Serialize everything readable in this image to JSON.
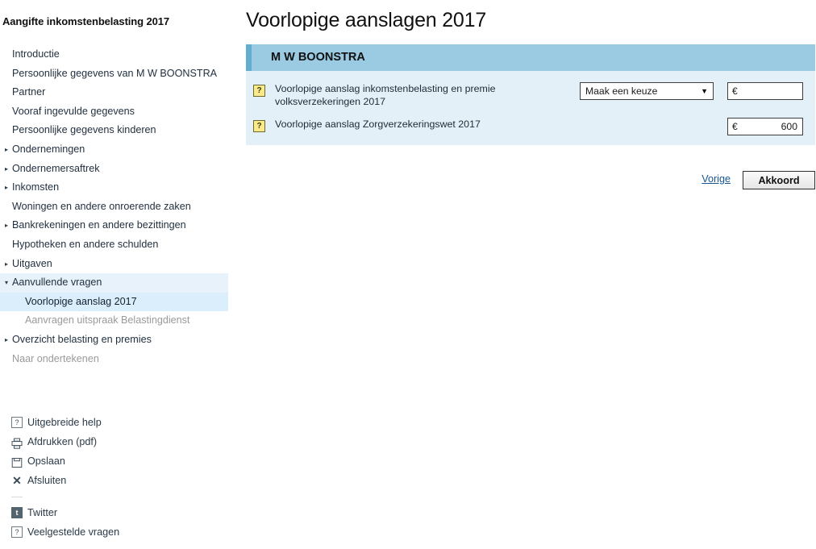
{
  "sidebar": {
    "title": "Aangifte inkomstenbelasting 2017",
    "items": [
      {
        "label": "Introductie",
        "level": 0,
        "arrow": "",
        "state": "normal"
      },
      {
        "label": "Persoonlijke gegevens van M W BOONSTRA",
        "level": 0,
        "arrow": "",
        "state": "normal"
      },
      {
        "label": "Partner",
        "level": 0,
        "arrow": "",
        "state": "normal"
      },
      {
        "label": "Vooraf ingevulde gegevens",
        "level": 0,
        "arrow": "",
        "state": "normal"
      },
      {
        "label": "Persoonlijke gegevens kinderen",
        "level": 0,
        "arrow": "",
        "state": "normal"
      },
      {
        "label": "Ondernemingen",
        "level": 0,
        "arrow": "▸",
        "state": "normal"
      },
      {
        "label": "Ondernemersaftrek",
        "level": 0,
        "arrow": "▸",
        "state": "normal"
      },
      {
        "label": "Inkomsten",
        "level": 0,
        "arrow": "▸",
        "state": "normal"
      },
      {
        "label": "Woningen en andere onroerende zaken",
        "level": 0,
        "arrow": "",
        "state": "normal"
      },
      {
        "label": "Bankrekeningen en andere bezittingen",
        "level": 0,
        "arrow": "▸",
        "state": "normal"
      },
      {
        "label": "Hypotheken en andere schulden",
        "level": 0,
        "arrow": "",
        "state": "normal"
      },
      {
        "label": "Uitgaven",
        "level": 0,
        "arrow": "▸",
        "state": "normal"
      },
      {
        "label": "Aanvullende vragen",
        "level": 0,
        "arrow": "▾",
        "state": "expanded"
      },
      {
        "label": "Voorlopige aanslag 2017",
        "level": 1,
        "arrow": "",
        "state": "selected"
      },
      {
        "label": "Aanvragen uitspraak Belastingdienst",
        "level": 1,
        "arrow": "",
        "state": "disabled"
      },
      {
        "label": "Overzicht belasting en premies",
        "level": 0,
        "arrow": "▸",
        "state": "normal"
      },
      {
        "label": "Naar ondertekenen",
        "level": 0,
        "arrow": "",
        "state": "disabled"
      }
    ],
    "footer": {
      "group1": [
        {
          "label": "Uitgebreide help",
          "icon": "question-box-icon",
          "glyph": "?"
        },
        {
          "label": "Afdrukken (pdf)",
          "icon": "printer-icon",
          "glyph": ""
        },
        {
          "label": "Opslaan",
          "icon": "save-icon",
          "glyph": ""
        },
        {
          "label": "Afsluiten",
          "icon": "close-x-icon",
          "glyph": "✕"
        }
      ],
      "group2": [
        {
          "label": "Twitter",
          "icon": "twitter-icon",
          "glyph": "t"
        },
        {
          "label": "Veelgestelde vragen",
          "icon": "question-box-icon",
          "glyph": "?"
        }
      ]
    }
  },
  "main": {
    "page_title": "Voorlopige aanslagen 2017",
    "panel": {
      "header_title": "M W BOONSTRA",
      "rows": [
        {
          "help_glyph": "?",
          "label": "Voorlopige aanslag inkomstenbelasting en premie volksverzekeringen 2017",
          "select": {
            "value": "Maak een keuze",
            "caret": "▼"
          },
          "money": {
            "currency": "€",
            "value": ""
          }
        },
        {
          "help_glyph": "?",
          "label": "Voorlopige aanslag Zorgverzekeringswet 2017",
          "select": null,
          "money": {
            "currency": "€",
            "value": "600"
          }
        }
      ]
    },
    "actions": {
      "previous_link": "Vorige",
      "submit_button": "Akkoord"
    }
  },
  "colors": {
    "panel_header": "#9bcbe3",
    "panel_header_edge": "#62aed1",
    "panel_body": "#e4f0f8",
    "nav_highlight": "#e7f2fa",
    "nav_highlight_strong": "#dbeefb",
    "help_icon": "#fbe98a",
    "link": "#16558f"
  }
}
